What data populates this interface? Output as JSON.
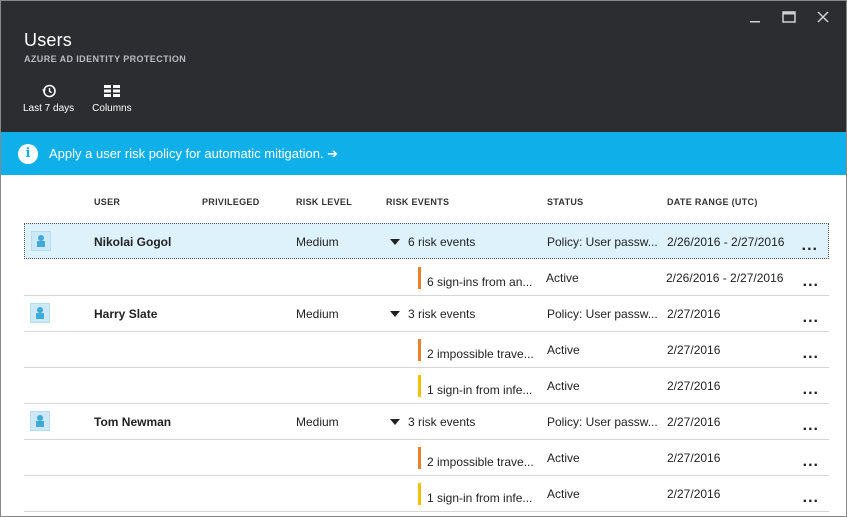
{
  "window": {
    "title": "Users",
    "subtitle": "AZURE AD IDENTITY PROTECTION"
  },
  "toolbar": {
    "range_label": "Last 7 days",
    "columns_label": "Columns"
  },
  "banner": {
    "text": "Apply a user risk policy for automatic mitigation. ➔"
  },
  "columns": {
    "user": "USER",
    "privileged": "PRIVILEGED",
    "risk_level": "RISK LEVEL",
    "risk_events": "RISK EVENTS",
    "status": "STATUS",
    "date_range": "DATE RANGE (UTC)"
  },
  "rows": [
    {
      "type": "user",
      "user": "Nikolai Gogol",
      "risk_level": "Medium",
      "events": "6 risk events",
      "status": "Policy: User passw...",
      "date": "2/26/2016 - 2/27/2016",
      "more": "..."
    },
    {
      "type": "event",
      "events": "6 sign-ins from an...",
      "severity_color": "#e8822a",
      "status": "Active",
      "date": "2/26/2016 - 2/27/2016",
      "more": "..."
    },
    {
      "type": "user",
      "user": "Harry Slate",
      "risk_level": "Medium",
      "events": "3 risk events",
      "status": "Policy: User passw...",
      "date": "2/27/2016",
      "more": "..."
    },
    {
      "type": "event",
      "events": "2 impossible trave...",
      "severity_color": "#e8822a",
      "status": "Active",
      "date": "2/27/2016",
      "more": "..."
    },
    {
      "type": "event",
      "events": "1 sign-in from infe...",
      "severity_color": "#f2c200",
      "status": "Active",
      "date": "2/27/2016",
      "more": "..."
    },
    {
      "type": "user",
      "user": "Tom Newman",
      "risk_level": "Medium",
      "events": "3 risk events",
      "status": "Policy: User passw...",
      "date": "2/27/2016",
      "more": "..."
    },
    {
      "type": "event",
      "events": "2 impossible trave...",
      "severity_color": "#e8822a",
      "status": "Active",
      "date": "2/27/2016",
      "more": "..."
    },
    {
      "type": "event",
      "events": "1 sign-in from infe...",
      "severity_color": "#f2c200",
      "status": "Active",
      "date": "2/27/2016",
      "more": "..."
    }
  ],
  "colors": {
    "header_bg": "#2b2d30",
    "banner_bg": "#0fb0ea",
    "selected_row_bg": "#ddf2fb"
  }
}
